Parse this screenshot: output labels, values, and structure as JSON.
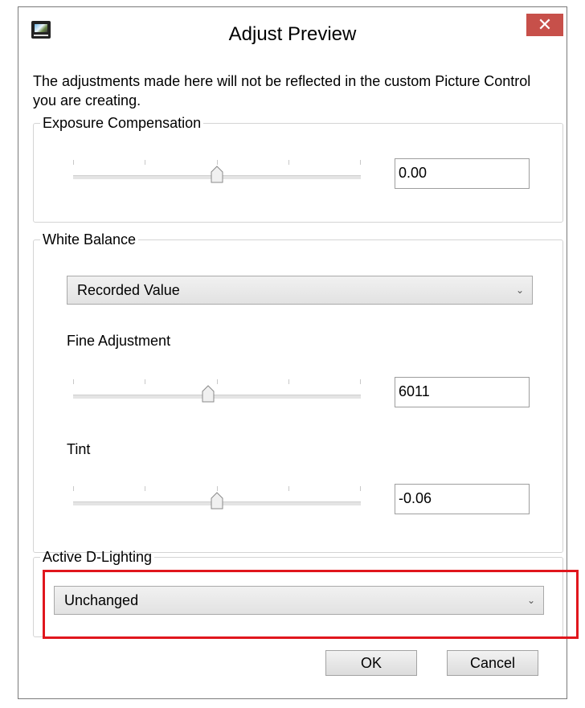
{
  "window": {
    "title": "Adjust Preview",
    "app_icon": "picture-control-icon",
    "close_label": "✕"
  },
  "notice": "The adjustments made here will not be reflected in the custom Picture Control you are creating.",
  "exposure": {
    "legend": "Exposure Compensation",
    "slider_level": 0.5,
    "value": "0.00"
  },
  "white_balance": {
    "legend": "White Balance",
    "mode": "Recorded Value",
    "fine_label": "Fine Adjustment",
    "fine_slider_level": 0.47,
    "fine_value": "6011",
    "tint_label": "Tint",
    "tint_slider_level": 0.5,
    "tint_value": "-0.06"
  },
  "adl": {
    "legend": "Active D-Lighting",
    "value": "Unchanged"
  },
  "buttons": {
    "ok": "OK",
    "cancel": "Cancel"
  },
  "colors": {
    "highlight": "#e0161d",
    "close_bg": "#c7504a"
  }
}
